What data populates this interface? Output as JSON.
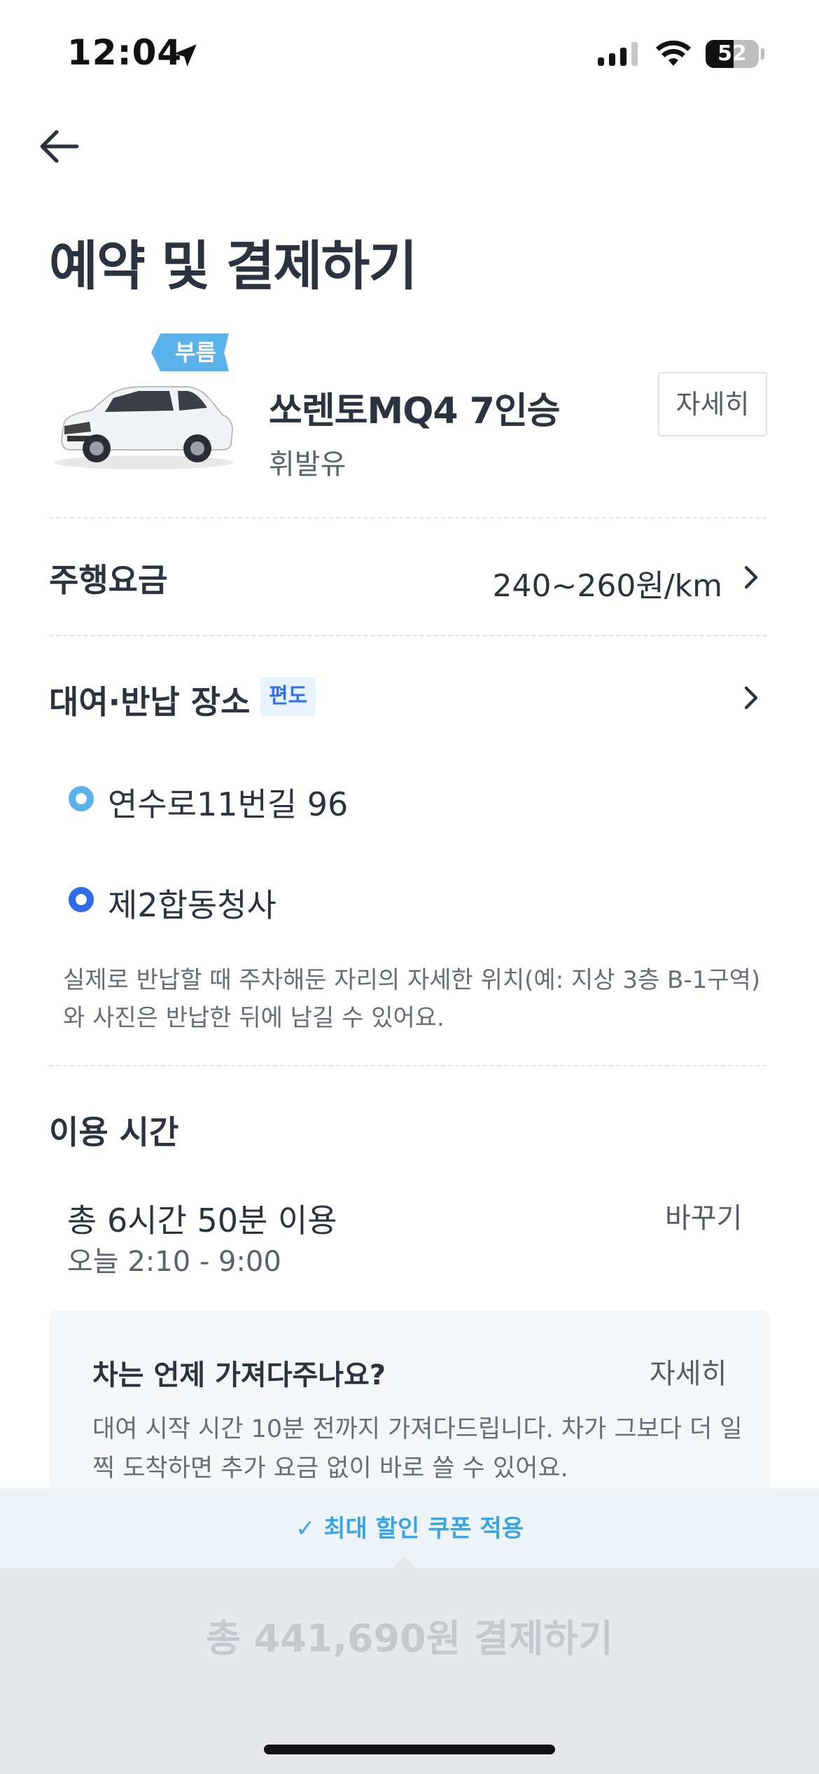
{
  "status_bar": {
    "time": "12:04",
    "battery": "52"
  },
  "header": {
    "title": "예약 및 결제하기"
  },
  "car": {
    "badge": "부름",
    "name": "쏘렌토MQ4 7인승",
    "fuel": "휘발유",
    "detail_label": "자세히"
  },
  "fare": {
    "label": "주행요금",
    "value": "240~260원/km"
  },
  "location": {
    "label": "대여·반납 장소",
    "tag": "편도",
    "start": "연수로11번길 96",
    "end": "제2합동청사",
    "note": "실제로 반납할 때 주차해둔 자리의 자세한 위치(예: 지상 3층 B-1구역)와 사진은 반납한 뒤에 남길 수 있어요."
  },
  "usage_time": {
    "label": "이용 시간",
    "total": "총 6시간 50분 이용",
    "range": "오늘 2:10 - 9:00",
    "change_label": "바꾸기"
  },
  "delivery_info": {
    "title": "차는 언제 가져다주나요?",
    "detail_label": "자세히",
    "text": "대여 시작 시간 10분 전까지 가져다드립니다. 차가 그보다 더 일찍 도착하면 추가 요금 없이 바로 쓸 수 있어요."
  },
  "coupon": {
    "text": "✓ 최대 할인 쿠폰 적용"
  },
  "payment": {
    "button_label": "총 441,690원 결제하기"
  },
  "colors": {
    "accent_sky": "#59b3ea",
    "accent_blue": "#2f6be6",
    "text_dark": "#2b3240"
  }
}
